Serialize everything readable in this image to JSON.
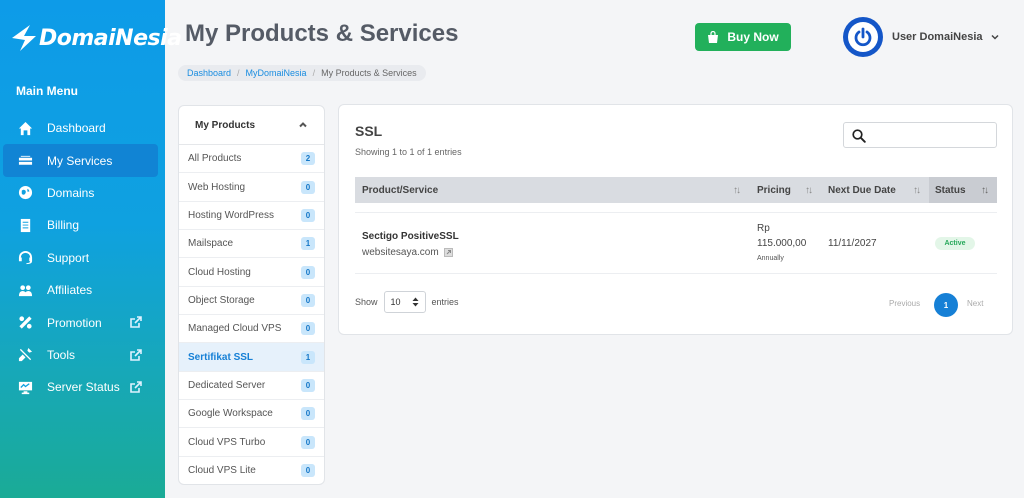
{
  "brand": {
    "name": "DomaiNesia"
  },
  "sidebar": {
    "menu_title": "Main Menu",
    "items": [
      {
        "label": "Dashboard",
        "icon": "home-icon"
      },
      {
        "label": "My Services",
        "icon": "server-icon",
        "active": true
      },
      {
        "label": "Domains",
        "icon": "globe-icon"
      },
      {
        "label": "Billing",
        "icon": "invoice-icon"
      },
      {
        "label": "Support",
        "icon": "headset-icon"
      },
      {
        "label": "Affiliates",
        "icon": "users-icon"
      },
      {
        "label": "Promotion",
        "icon": "percent-icon",
        "external": true
      },
      {
        "label": "Tools",
        "icon": "tools-icon",
        "external": true
      },
      {
        "label": "Server Status",
        "icon": "monitor-icon",
        "external": true
      }
    ]
  },
  "header": {
    "title": "My Products & Services",
    "breadcrumb": [
      "Dashboard",
      "MyDomaiNesia",
      "My Products & Services"
    ],
    "buy_label": "Buy Now",
    "user_name": "User DomaiNesia"
  },
  "products_panel": {
    "title": "My Products",
    "items": [
      {
        "label": "All Products",
        "count": "2"
      },
      {
        "label": "Web Hosting",
        "count": "0"
      },
      {
        "label": "Hosting WordPress",
        "count": "0"
      },
      {
        "label": "Mailspace",
        "count": "1"
      },
      {
        "label": "Cloud Hosting",
        "count": "0"
      },
      {
        "label": "Object Storage",
        "count": "0"
      },
      {
        "label": "Managed Cloud VPS",
        "count": "0"
      },
      {
        "label": "Sertifikat SSL",
        "count": "1",
        "active": true
      },
      {
        "label": "Dedicated Server",
        "count": "0"
      },
      {
        "label": "Google Workspace",
        "count": "0"
      },
      {
        "label": "Cloud VPS Turbo",
        "count": "0"
      },
      {
        "label": "Cloud VPS Lite",
        "count": "0"
      }
    ]
  },
  "main": {
    "title": "SSL",
    "showing": "Showing 1 to 1 of 1 entries",
    "search": {
      "placeholder": "",
      "value": ""
    },
    "columns": [
      "Product/Service",
      "Pricing",
      "Next Due Date",
      "Status"
    ],
    "rows": [
      {
        "name": "Sectigo PositiveSSL",
        "domain": "websitesaya.com",
        "price_currency": "Rp",
        "price_value": "115.000,00",
        "billing_cycle": "Annually",
        "due_date": "11/11/2027",
        "status": "Active"
      }
    ],
    "show_label": "Show",
    "entries_label": "entries",
    "page_size": "10",
    "pagination": {
      "prev": "Previous",
      "current": "1",
      "next": "Next"
    }
  },
  "colors": {
    "accent": "#1680d6",
    "buy_button": "#22b05b",
    "status_active": "#26a85a"
  }
}
